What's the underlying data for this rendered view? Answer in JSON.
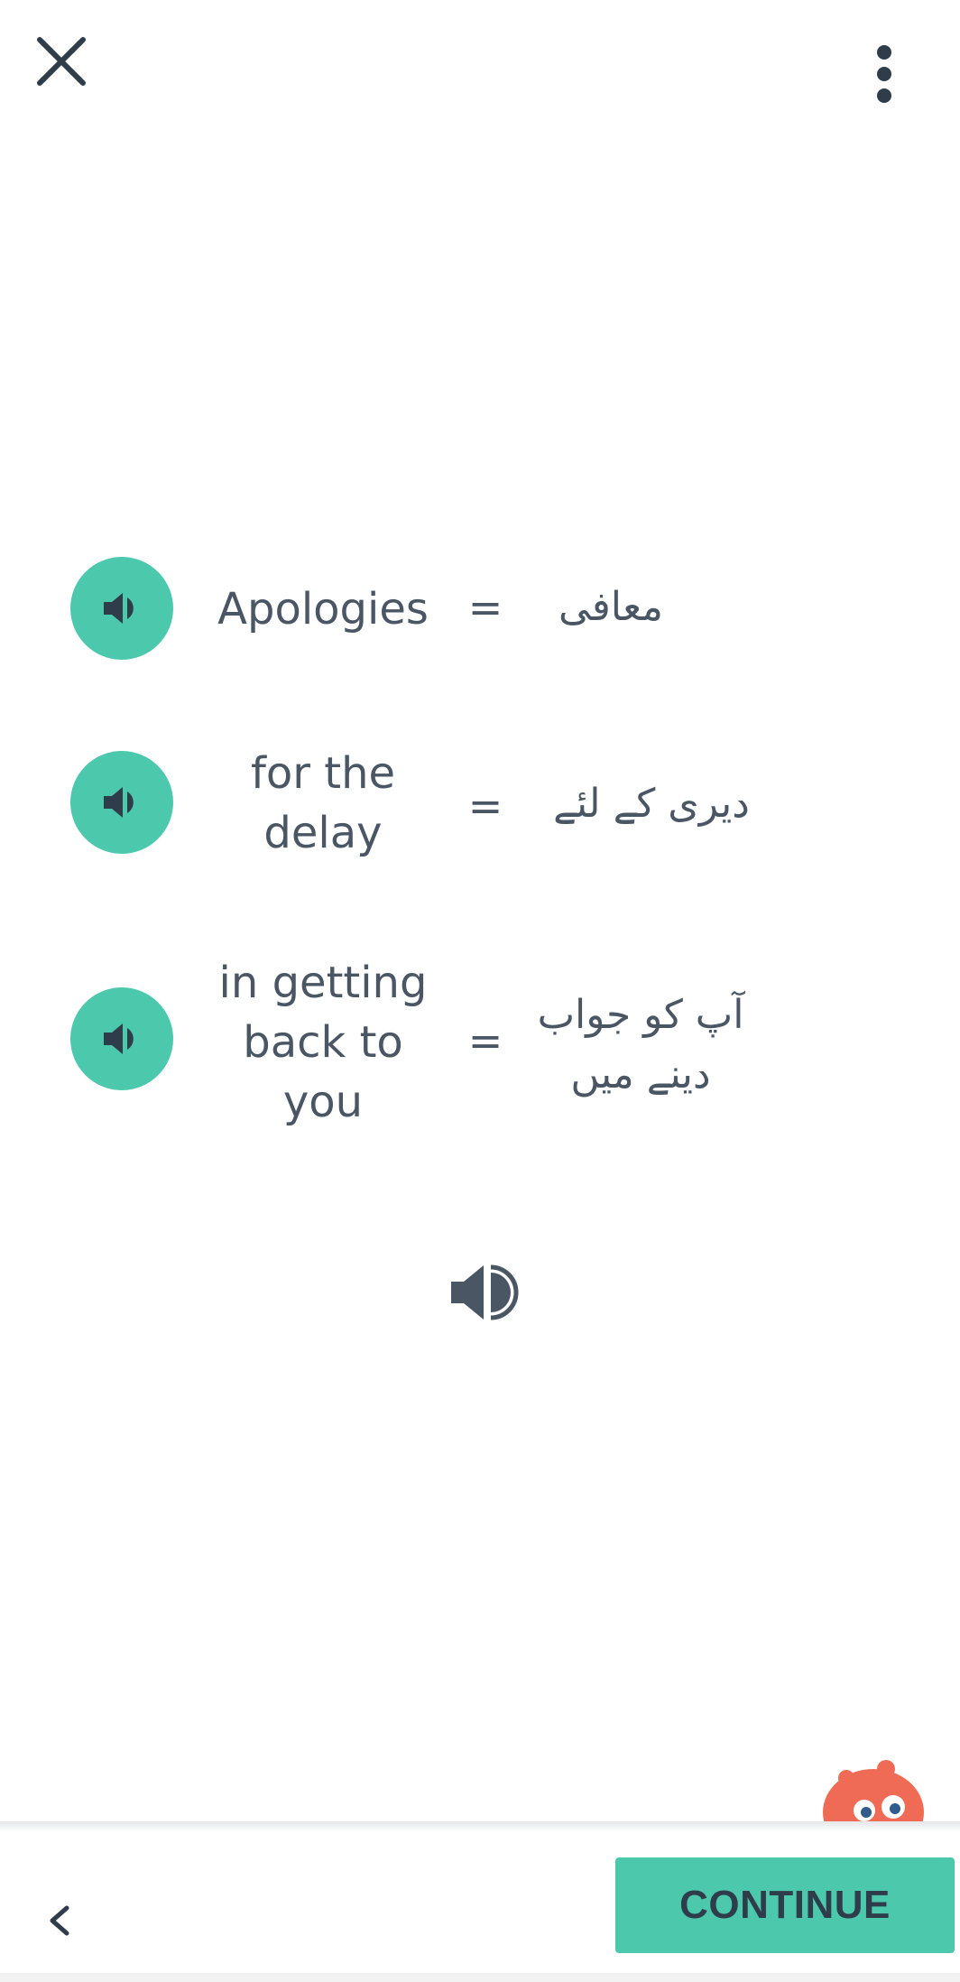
{
  "header": {
    "close_icon": "close-icon",
    "more_icon": "more-vertical-icon"
  },
  "phrases": [
    {
      "english": "Apologies",
      "equals": "=",
      "urdu": "معافی"
    },
    {
      "english": "for the delay",
      "equals": "=",
      "urdu": "دیری کے لئے"
    },
    {
      "english": "in getting back to you",
      "equals": "=",
      "urdu": "آپ کو جواب دینے میں"
    }
  ],
  "footer": {
    "back_icon": "chevron-left-icon",
    "continue_label": "CONTINUE"
  },
  "colors": {
    "accent": "#4cc9ad",
    "text": "#4a5664",
    "mascot": "#f06b55"
  }
}
